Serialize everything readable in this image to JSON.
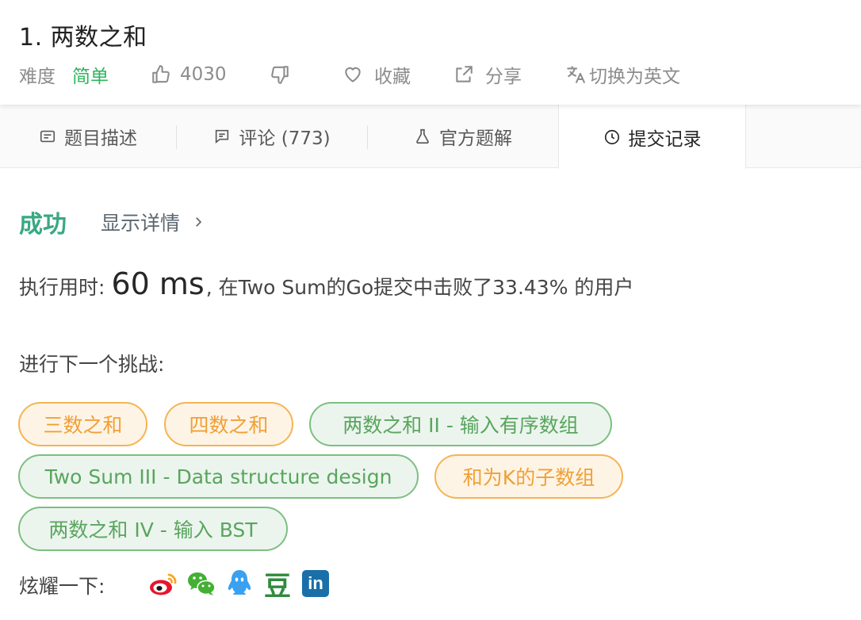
{
  "problem": {
    "title": "1. 两数之和",
    "difficulty_label": "难度",
    "difficulty_value": "简单",
    "likes": "4030",
    "favorite_label": "收藏",
    "share_label": "分享",
    "switch_lang_label": "切换为英文"
  },
  "tabs": [
    {
      "label": "题目描述"
    },
    {
      "label": "评论 (773)"
    },
    {
      "label": "官方题解"
    },
    {
      "label": "提交记录"
    }
  ],
  "result": {
    "status": "成功",
    "show_detail": "显示详情",
    "runtime_prefix": "执行用时:",
    "runtime_value": "60 ms",
    "runtime_suffix": ", 在Two Sum的Go提交中击败了33.43% 的用户"
  },
  "next_challenge": {
    "label": "进行下一个挑战:",
    "items": [
      {
        "label": "三数之和",
        "difficulty_color": "#f0a036"
      },
      {
        "label": "四数之和",
        "difficulty_color": "#f0a036"
      },
      {
        "label": "两数之和 II - 输入有序数组",
        "difficulty_color": "#5aa55e"
      },
      {
        "label": "Two Sum III - Data structure design",
        "difficulty_color": "#5aa55e"
      },
      {
        "label": "和为K的子数组",
        "difficulty_color": "#f0a036"
      },
      {
        "label": "两数之和 IV - 输入 BST",
        "difficulty_color": "#5aa55e"
      }
    ]
  },
  "share": {
    "label": "炫耀一下:",
    "icons": [
      "weibo-icon",
      "wechat-icon",
      "qq-icon",
      "douban-icon",
      "linkedin-icon"
    ],
    "douban_glyph": "豆",
    "linkedin_glyph": "in"
  },
  "colors": {
    "accent_green": "#2db55d",
    "success": "#3aa882",
    "medium_orange": "#f0a036",
    "easy_green": "#5aa55e"
  }
}
